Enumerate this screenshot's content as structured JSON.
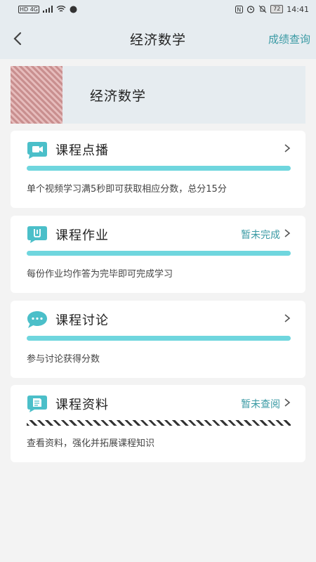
{
  "status_bar": {
    "left": "HD 4G",
    "battery": "72",
    "time": "14:41"
  },
  "nav": {
    "title": "经济数学",
    "action": "成绩查询"
  },
  "course": {
    "name": "经济数学"
  },
  "cards": [
    {
      "icon": "video-camera-icon",
      "title": "课程点播",
      "status": "",
      "desc": "单个视频学习满5秒即可获取相应分数，总分15分",
      "progress_style": "solid"
    },
    {
      "icon": "homework-icon",
      "title": "课程作业",
      "status": "暂未完成",
      "desc": "每份作业均作答为完毕即可完成学习",
      "progress_style": "solid"
    },
    {
      "icon": "chat-bubble-icon",
      "title": "课程讨论",
      "status": "",
      "desc": "参与讨论获得分数",
      "progress_style": "solid"
    },
    {
      "icon": "document-icon",
      "title": "课程资料",
      "status": "暂未查阅",
      "desc": "查看资料，强化并拓展课程知识",
      "progress_style": "dashed"
    }
  ],
  "colors": {
    "accent": "#3a9aa4",
    "progress": "#6fd6de",
    "icon_bg": "#4bbfc9",
    "header_bg": "#e6ecf0"
  }
}
